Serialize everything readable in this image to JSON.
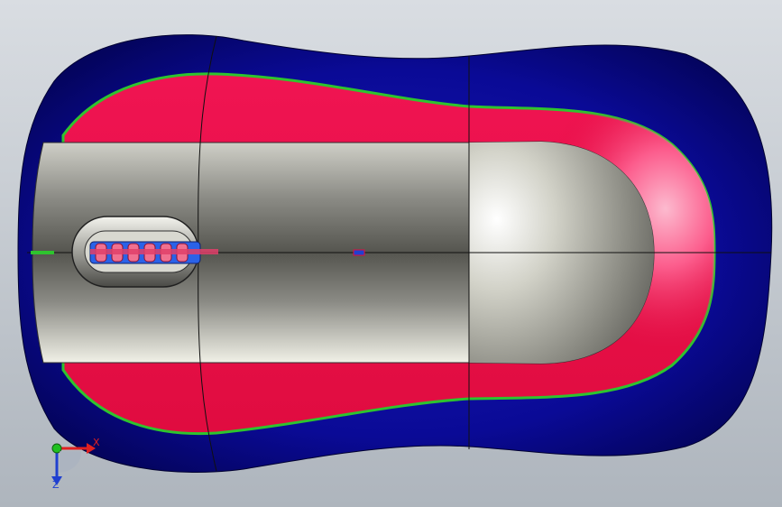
{
  "viewport": {
    "background_top": "#d7dbe0",
    "background_bottom": "#a9b0b8"
  },
  "model": {
    "outer_shell_color": "#0a0a8a",
    "side_panel_color": "#e8124a",
    "seam_color": "#2ec42e",
    "top_panel_color": "#c8c8c0",
    "scroll_wheel_color": "#e85a7a",
    "wheel_slot_color": "#1e6cff"
  },
  "triad": {
    "x_label": "X",
    "z_label": "Z",
    "x_color": "#e02020",
    "y_color": "#20c020",
    "z_color": "#2040d0"
  }
}
